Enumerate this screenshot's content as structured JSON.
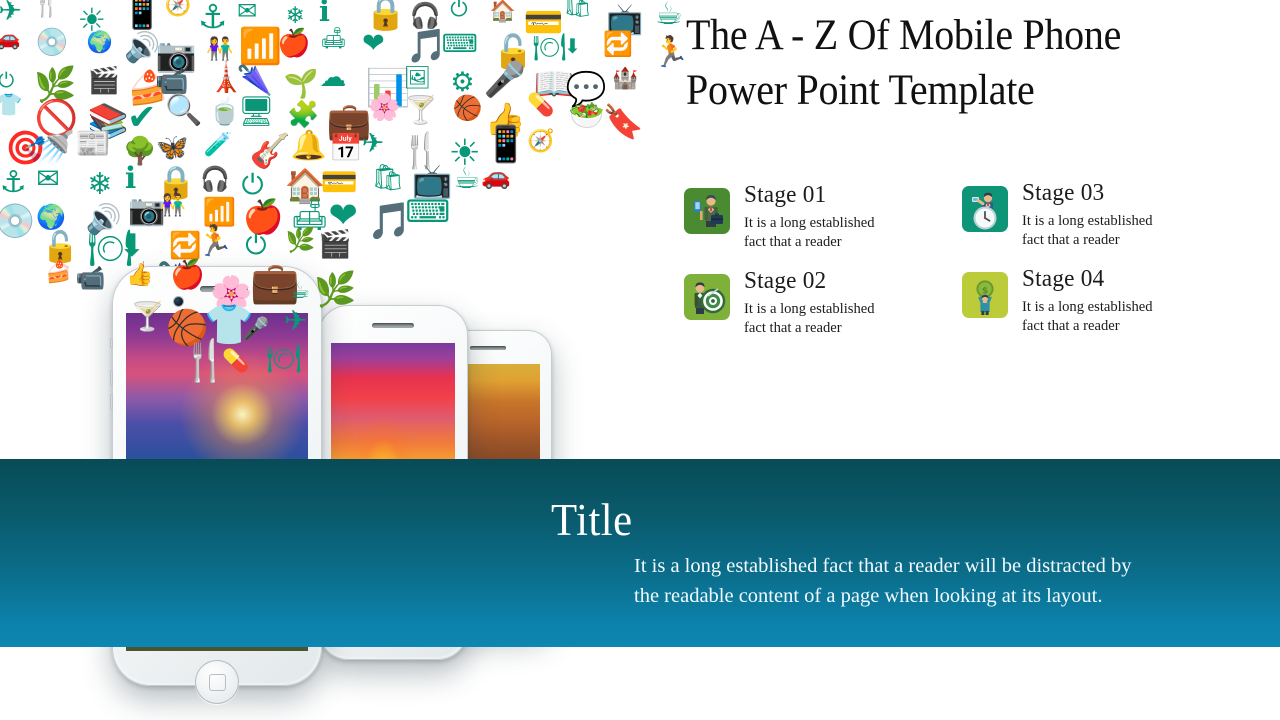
{
  "slide": {
    "title": "The A - Z Of Mobile Phone\nPower Point Template",
    "accent_icon_color": "#089878",
    "banner_gradient_top": "#084b57",
    "banner_gradient_bottom": "#0d86b1"
  },
  "stages": [
    {
      "label": "Stage 01",
      "description": "It is a long established\nfact that a reader",
      "box_color": "#4a8b32",
      "icon": "businessman-with-phone-icon"
    },
    {
      "label": "Stage 02",
      "description": "It is a long established\nfact that a reader",
      "box_color": "#7fb03a",
      "icon": "businessman-with-target-icon"
    },
    {
      "label": "Stage 03",
      "description": "It is a long established\nfact that a reader",
      "box_color": "#0e9477",
      "icon": "businessman-on-clock-icon"
    },
    {
      "label": "Stage 04",
      "description": "It is a long established\nfact that a reader",
      "box_color": "#bccb3a",
      "icon": "person-holding-coin-icon"
    }
  ],
  "banner": {
    "title": "Title",
    "body": "It is a long established fact that a reader will be distracted by\nthe readable content of a page when looking at its layout."
  },
  "phones": [
    {
      "name": "front-phone",
      "wallpaper": "mountain-flowers-sunset-wallpaper"
    },
    {
      "name": "middle-phone",
      "wallpaper": "purple-heather-sunset-wallpaper"
    },
    {
      "name": "back-phone",
      "wallpaper": "autumn-forest-path-wallpaper"
    }
  ],
  "icon_cloud": {
    "color": "#089878",
    "glyphs": [
      "✈",
      "🍴",
      "☀",
      "📱",
      "🧭",
      "⚓",
      "✉",
      "❄",
      "ℹ",
      "🔒",
      "🎧",
      "⏻",
      "🏠",
      "💳",
      "🛍",
      "📺",
      "☕",
      "🚗",
      "💿",
      "🌍",
      "🔊",
      "📷",
      "👫",
      "📶",
      "🍎",
      "🛋",
      "❤",
      "🎵",
      "⌨",
      "🔓",
      "🍽",
      "⬇",
      "🔁",
      "🏃",
      "⏻",
      "🌿",
      "🎬",
      "🍰",
      "📹",
      "🗼",
      "🌂",
      "🌱",
      "☁",
      "📊",
      "🖼",
      "⚙",
      "🎤",
      "📖",
      "💬",
      "🏰",
      "👕",
      "🚫",
      "📚",
      "✔",
      "🔍",
      "🍵",
      "🖥",
      "🧩",
      "💼",
      "🌸",
      "🍸",
      "🏀",
      "👍",
      "💊",
      "🥗",
      "🔖",
      "🎯",
      "🚿",
      "📰",
      "🌳",
      "🦋",
      "🧪",
      "🎸",
      "🔔",
      "📅"
    ]
  }
}
